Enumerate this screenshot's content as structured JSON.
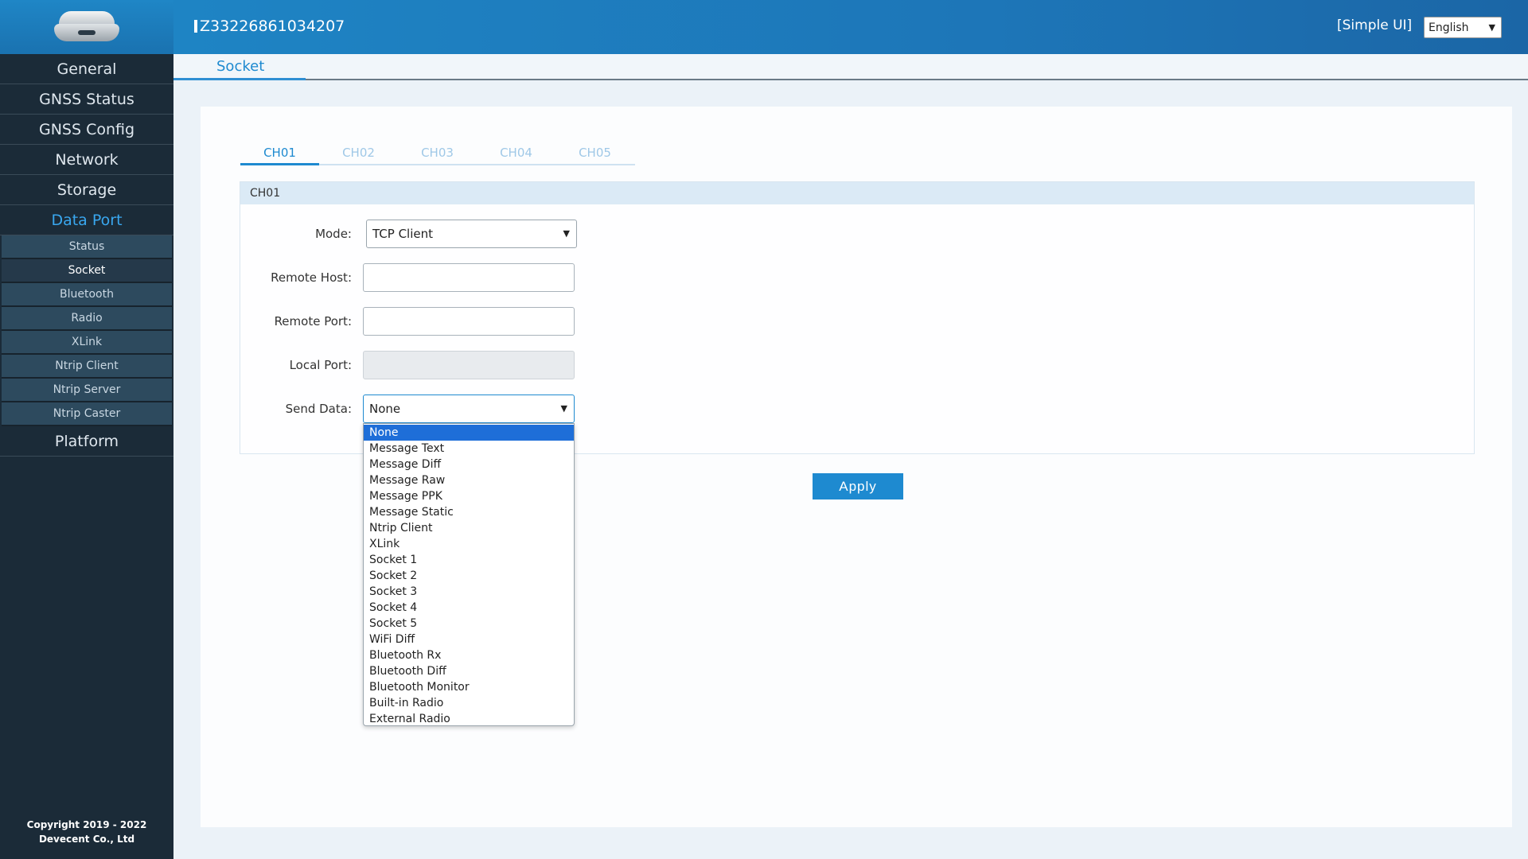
{
  "header": {
    "device_id": "Z33226861034207",
    "simple_ui_label": "[Simple UI]",
    "language_value": "English"
  },
  "sidebar": {
    "items_top": [
      {
        "label": "General"
      },
      {
        "label": "GNSS Status"
      },
      {
        "label": "GNSS Config"
      },
      {
        "label": "Network"
      },
      {
        "label": "Storage"
      },
      {
        "label": "Data Port"
      }
    ],
    "sub_items": [
      {
        "label": "Status"
      },
      {
        "label": "Socket"
      },
      {
        "label": "Bluetooth"
      },
      {
        "label": "Radio"
      },
      {
        "label": "XLink"
      },
      {
        "label": "Ntrip Client"
      },
      {
        "label": "Ntrip Server"
      },
      {
        "label": "Ntrip Caster"
      }
    ],
    "items_bottom": [
      {
        "label": "Platform"
      }
    ],
    "copyright_line1": "Copyright 2019 - 2022",
    "copyright_line2": "Devecent Co., Ltd"
  },
  "page_tab": "Socket",
  "channel_tabs": [
    "CH01",
    "CH02",
    "CH03",
    "CH04",
    "CH05"
  ],
  "section_title": "CH01",
  "form": {
    "mode_label": "Mode:",
    "mode_value": "TCP Client",
    "remote_host_label": "Remote Host:",
    "remote_host_value": "",
    "remote_port_label": "Remote Port:",
    "remote_port_value": "",
    "local_port_label": "Local Port:",
    "local_port_value": "",
    "send_data_label": "Send Data:",
    "send_data_value": "None"
  },
  "send_data_options": [
    "None",
    "Message Text",
    "Message Diff",
    "Message Raw",
    "Message PPK",
    "Message Static",
    "Ntrip Client",
    "XLink",
    "Socket 1",
    "Socket 2",
    "Socket 3",
    "Socket 4",
    "Socket 5",
    "WiFi Diff",
    "Bluetooth Rx",
    "Bluetooth Diff",
    "Bluetooth Monitor",
    "Built-in Radio",
    "External Radio"
  ],
  "apply_label": "Apply"
}
